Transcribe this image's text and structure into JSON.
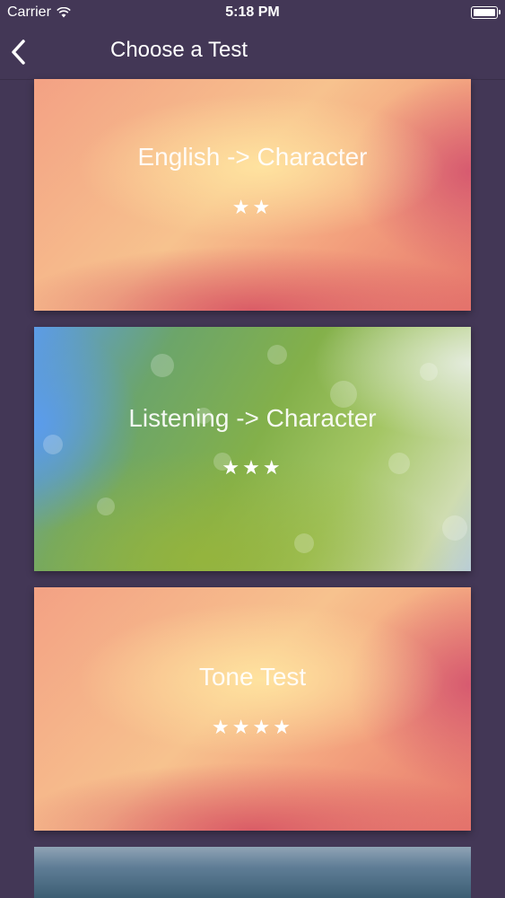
{
  "status_bar": {
    "carrier": "Carrier",
    "time": "5:18 PM"
  },
  "nav": {
    "back_icon": "chevron-left-icon",
    "title": "Choose a Test"
  },
  "tests": [
    {
      "title": "English -> Character",
      "stars": "★★",
      "rating": 2,
      "theme": "warm"
    },
    {
      "title": "Listening -> Character",
      "stars": "★★★",
      "rating": 3,
      "theme": "green"
    },
    {
      "title": "Tone Test",
      "stars": "★★★★",
      "rating": 4,
      "theme": "warm"
    },
    {
      "title": "",
      "stars": "",
      "theme": "dusk"
    }
  ],
  "colors": {
    "background": "#433756",
    "text": "#ffffff"
  }
}
